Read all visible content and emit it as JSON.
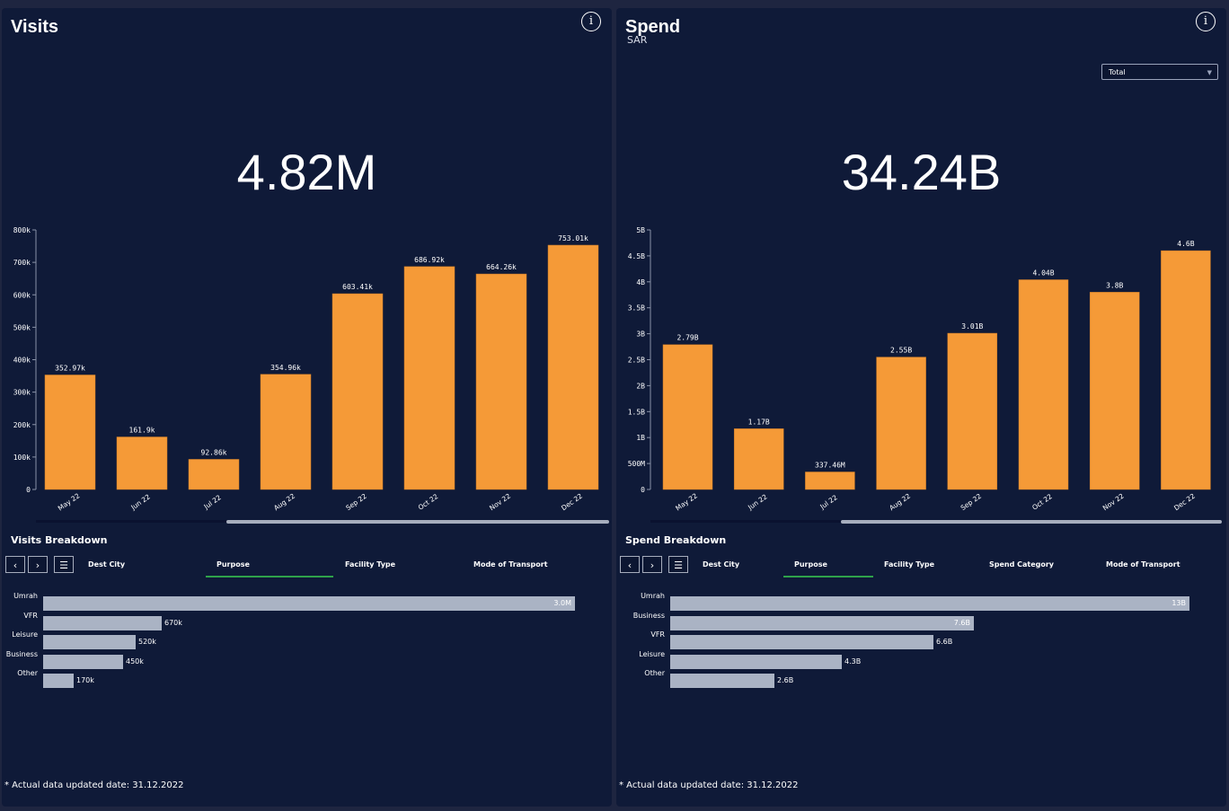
{
  "colors": {
    "bar": "#f59a37",
    "breakdown_bar": "#aab3c4",
    "tab_accent": "#2fa24a",
    "panel_bg": "#0f1a38"
  },
  "visits": {
    "title": "Visits",
    "kpi": "4.82M",
    "chart_data": {
      "type": "bar",
      "categories": [
        "May 22",
        "Jun 22",
        "Jul 22",
        "Aug 22",
        "Sep 22",
        "Oct 22",
        "Nov 22",
        "Dec 22"
      ],
      "values": [
        352970,
        161900,
        92860,
        354960,
        603410,
        686920,
        664260,
        753010
      ],
      "data_labels": [
        "352.97k",
        "161.9k",
        "92.86k",
        "354.96k",
        "603.41k",
        "686.92k",
        "664.26k",
        "753.01k"
      ],
      "yticks": [
        "0",
        "100k",
        "200k",
        "300k",
        "400k",
        "500k",
        "600k",
        "700k",
        "800k"
      ],
      "ylim": [
        0,
        800000
      ]
    },
    "breakdown_title": "Visits Breakdown",
    "tabs": [
      "Dest City",
      "Purpose",
      "Facility Type",
      "Mode of Transport"
    ],
    "active_tab": "Purpose",
    "breakdown": [
      {
        "label": "Umrah",
        "value": 3.0,
        "text": "3.0M"
      },
      {
        "label": "VFR",
        "value": 0.67,
        "text": "670k"
      },
      {
        "label": "Leisure",
        "value": 0.52,
        "text": "520k"
      },
      {
        "label": "Business",
        "value": 0.45,
        "text": "450k"
      },
      {
        "label": "Other",
        "value": 0.17,
        "text": "170k"
      }
    ],
    "footnote": "* Actual data updated date: 31.12.2022"
  },
  "spend": {
    "title": "Spend",
    "subtitle": "SAR",
    "select_value": "Total",
    "kpi": "34.24B",
    "chart_data": {
      "type": "bar",
      "categories": [
        "May 22",
        "Jun 22",
        "Jul 22",
        "Aug 22",
        "Sep 22",
        "Oct 22",
        "Nov 22",
        "Dec 22"
      ],
      "values": [
        2.79,
        1.17,
        0.33746,
        2.55,
        3.01,
        4.04,
        3.8,
        4.6
      ],
      "data_labels": [
        "2.79B",
        "1.17B",
        "337.46M",
        "2.55B",
        "3.01B",
        "4.04B",
        "3.8B",
        "4.6B"
      ],
      "yticks": [
        "0",
        "500M",
        "1B",
        "1.5B",
        "2B",
        "2.5B",
        "3B",
        "3.5B",
        "4B",
        "4.5B",
        "5B"
      ],
      "ylim": [
        0,
        5
      ]
    },
    "breakdown_title": "Spend Breakdown",
    "tabs": [
      "Dest City",
      "Purpose",
      "Facility Type",
      "Spend Category",
      "Mode of Transport"
    ],
    "active_tab": "Purpose",
    "breakdown": [
      {
        "label": "Umrah",
        "value": 13,
        "text": "13B"
      },
      {
        "label": "Business",
        "value": 7.6,
        "text": "7.6B"
      },
      {
        "label": "VFR",
        "value": 6.6,
        "text": "6.6B"
      },
      {
        "label": "Leisure",
        "value": 4.3,
        "text": "4.3B"
      },
      {
        "label": "Other",
        "value": 2.6,
        "text": "2.6B"
      }
    ],
    "footnote": "* Actual data updated date: 31.12.2022"
  },
  "icons": {
    "info": "info-icon",
    "prev": "chevron-left-icon",
    "next": "chevron-right-icon",
    "list": "list-icon",
    "dropdown": "chevron-down-icon"
  }
}
